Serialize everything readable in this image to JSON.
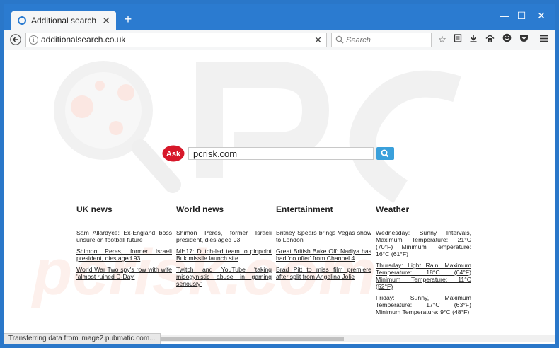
{
  "browser": {
    "tab_title": "Additional search",
    "new_tab_symbol": "+",
    "window_controls": {
      "minimize": "—",
      "maximize": "☐",
      "close": "✕"
    },
    "url": "additionalsearch.co.uk",
    "search_placeholder": "Search"
  },
  "ask": {
    "logo_text": "Ask",
    "query": "pcrisk.com"
  },
  "watermark_text": "pcrisk.com",
  "columns": {
    "uk": {
      "title": "UK news",
      "items": [
        "Sam Allardyce: Ex-England boss unsure on football future",
        "Shimon Peres, former Israeli president, dies aged 93",
        "World War Two spy's row with wife 'almost ruined D-Day'"
      ]
    },
    "world": {
      "title": "World news",
      "items": [
        "Shimon Peres, former Israeli president, dies aged 93",
        "MH17: Dutch-led team to pinpoint Buk missile launch site",
        "Twitch and YouTube 'taking misogynistic abuse in gaming seriously'"
      ]
    },
    "entertainment": {
      "title": "Entertainment",
      "items": [
        "Britney Spears brings Vegas show to London",
        "Great British Bake Off: Nadiya has had 'no offer' from Channel 4",
        "Brad Pitt to miss film premiere after split from Angelina Jolie"
      ]
    },
    "weather": {
      "title": "Weather",
      "items": [
        "Wednesday: Sunny Intervals, Maximum Temperature: 21°C (70°F) Minimum Temperature: 16°C (61°F)",
        "Thursday: Light Rain, Maximum Temperature: 18°C (64°F) Minimum Temperature: 11°C (52°F)",
        "Friday: Sunny, Maximum Temperature: 17°C (63°F) Minimum Temperature: 9°C (48°F)"
      ]
    }
  },
  "status_text": "Transferring data from image2.pubmatic.com...",
  "colors": {
    "titlebar": "#2b7bd0",
    "ask_red": "#d7182a",
    "ask_button": "#3aa0db"
  }
}
